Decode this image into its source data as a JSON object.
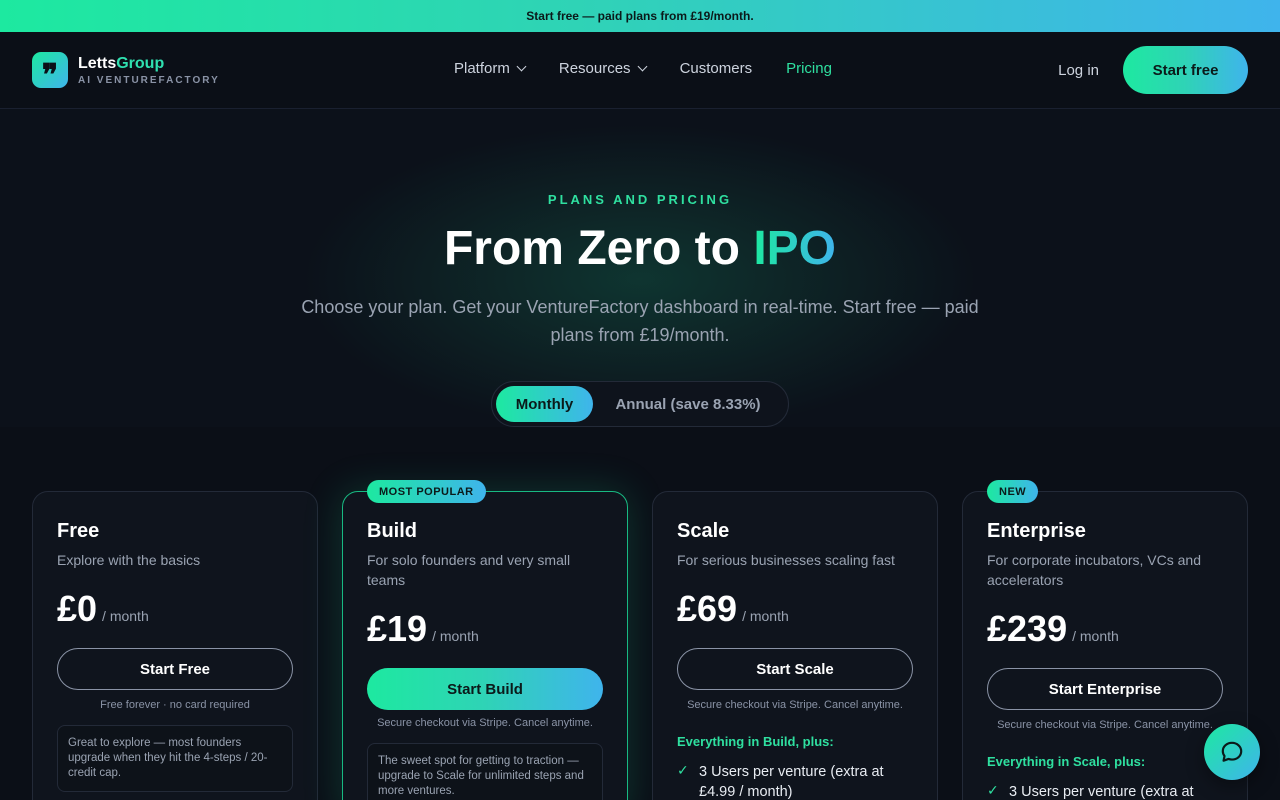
{
  "announcement": "Start free — paid plans from £19/month.",
  "brand": {
    "name_a": "Letts",
    "name_b": "Group",
    "tagline": "AI VENTUREFACTORY",
    "mark": "❞"
  },
  "nav": {
    "links": [
      {
        "label": "Platform",
        "dropdown": true
      },
      {
        "label": "Resources",
        "dropdown": true
      },
      {
        "label": "Customers",
        "dropdown": false
      },
      {
        "label": "Pricing",
        "dropdown": false,
        "active": true
      }
    ],
    "login": "Log in",
    "cta": "Start free"
  },
  "hero": {
    "eyebrow": "PLANS AND PRICING",
    "title_a": "From Zero to ",
    "title_b": "IPO",
    "subtitle": "Choose your plan. Get your VentureFactory dashboard in real-time. Start free — paid plans from £19/month."
  },
  "billing_toggle": {
    "monthly": "Monthly",
    "annual": "Annual (save 8.33%)",
    "selected": "monthly"
  },
  "plans": [
    {
      "name": "Free",
      "desc": "Explore with the basics",
      "price": "£0",
      "period": "/ month",
      "cta": "Start Free",
      "fine": "Free forever · no card required",
      "note": "Great to explore — most founders upgrade when they hit the 4-steps / 20-credit cap."
    },
    {
      "badge": "MOST POPULAR",
      "name": "Build",
      "desc": "For solo founders and very small teams",
      "price": "£19",
      "period": "/ month",
      "cta": "Start Build",
      "fine": "Secure checkout via Stripe. Cancel anytime.",
      "note": "The sweet spot for getting to traction — upgrade to Scale for unlimited steps and more ventures."
    },
    {
      "name": "Scale",
      "desc": "For serious businesses scaling fast",
      "price": "£69",
      "period": "/ month",
      "cta": "Start Scale",
      "fine": "Secure checkout via Stripe. Cancel anytime.",
      "plus": "Everything in Build, plus:",
      "feature": "3 Users per venture (extra at £4.99 / month)"
    },
    {
      "badge": "NEW",
      "name": "Enterprise",
      "desc": "For corporate incubators, VCs and accelerators",
      "price": "£239",
      "period": "/ month",
      "cta": "Start Enterprise",
      "fine": "Secure checkout via Stripe. Cancel anytime.",
      "plus": "Everything in Scale, plus:",
      "feature": "3 Users per venture (extra at"
    }
  ],
  "icons": {
    "chat": "chat-bubble-icon",
    "check": "check-icon",
    "chevron": "chevron-down-icon"
  },
  "colors": {
    "accent_green": "#1de9a0",
    "accent_blue": "#3fb4ec",
    "background": "#0b0f17"
  }
}
